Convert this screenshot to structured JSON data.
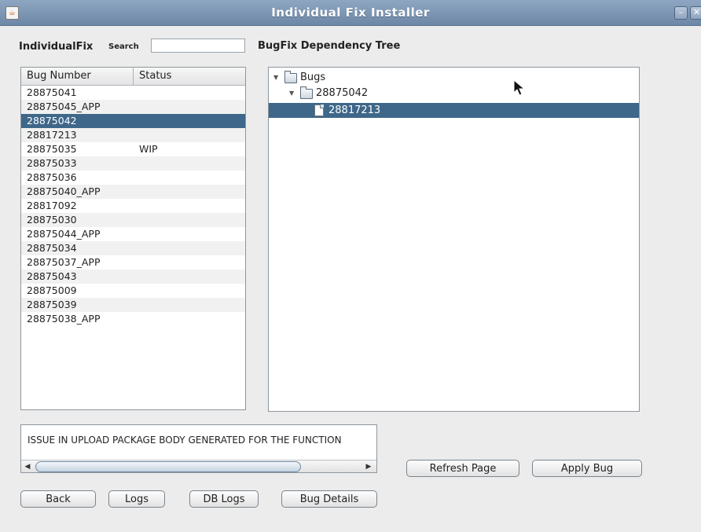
{
  "window": {
    "title": "Individual Fix Installer",
    "minimize_glyph": "–",
    "close_glyph": "✕",
    "app_icon_glyph": "☕"
  },
  "labels": {
    "individualfix": "IndividualFix",
    "search": "Search",
    "tree_title": "BugFix Dependency Tree"
  },
  "search": {
    "value": "",
    "placeholder": ""
  },
  "table": {
    "columns": [
      "Bug Number",
      "Status"
    ],
    "rows": [
      {
        "bug": "28875041",
        "status": ""
      },
      {
        "bug": "28875045_APP",
        "status": ""
      },
      {
        "bug": "28875042",
        "status": "",
        "selected": true
      },
      {
        "bug": "28817213",
        "status": ""
      },
      {
        "bug": "28875035",
        "status": "WIP"
      },
      {
        "bug": "28875033",
        "status": ""
      },
      {
        "bug": "28875036",
        "status": ""
      },
      {
        "bug": "28875040_APP",
        "status": ""
      },
      {
        "bug": "28817092",
        "status": ""
      },
      {
        "bug": "28875030",
        "status": ""
      },
      {
        "bug": "28875044_APP",
        "status": ""
      },
      {
        "bug": "28875034",
        "status": ""
      },
      {
        "bug": "28875037_APP",
        "status": ""
      },
      {
        "bug": "28875043",
        "status": ""
      },
      {
        "bug": "28875009",
        "status": ""
      },
      {
        "bug": "28875039",
        "status": ""
      },
      {
        "bug": "28875038_APP",
        "status": ""
      }
    ]
  },
  "tree": {
    "root": "Bugs",
    "child": "28875042",
    "leaf": "28817213",
    "expander_glyph": "▼"
  },
  "message": {
    "text": "ISSUE IN UPLOAD PACKAGE BODY GENERATED FOR THE FUNCTION",
    "scroll_left_glyph": "◀",
    "scroll_right_glyph": "▶"
  },
  "buttons": {
    "refresh": "Refresh Page",
    "apply": "Apply Bug",
    "back": "Back",
    "logs": "Logs",
    "db_logs": "DB Logs",
    "bug_details": "Bug Details"
  },
  "colors": {
    "selection": "#3e6789",
    "titlebar": "#7d96b4"
  }
}
